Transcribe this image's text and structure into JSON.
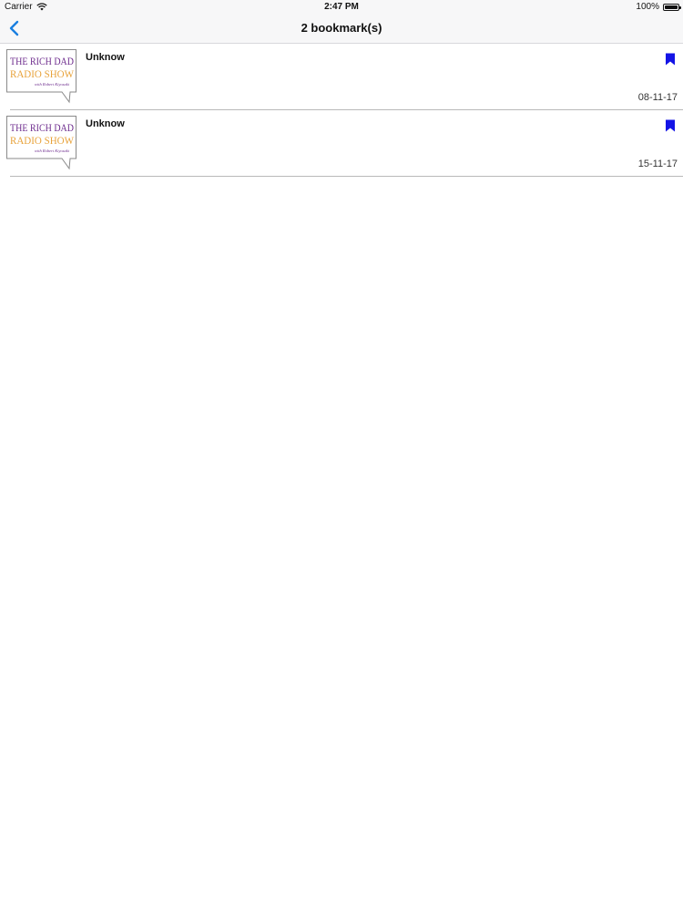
{
  "status_bar": {
    "carrier": "Carrier",
    "time": "2:47 PM",
    "battery_percent": "100%",
    "battery_level": 1.0
  },
  "nav": {
    "title": "2 bookmark(s)",
    "back_icon": "chevron-left-icon"
  },
  "colors": {
    "accent": "#1a7fe0",
    "bookmark": "#1414e6",
    "logo_purple": "#6c2a8c",
    "logo_orange": "#e8a23a"
  },
  "logo": {
    "line1": "THE RICH DAD",
    "line2": "RADIO SHOW",
    "line3": "with Robert Kiyosaki"
  },
  "bookmarks": [
    {
      "title": "Unknow",
      "date": "08-11-17",
      "icon": "bookmark-icon"
    },
    {
      "title": "Unknow",
      "date": "15-11-17",
      "icon": "bookmark-icon"
    }
  ]
}
